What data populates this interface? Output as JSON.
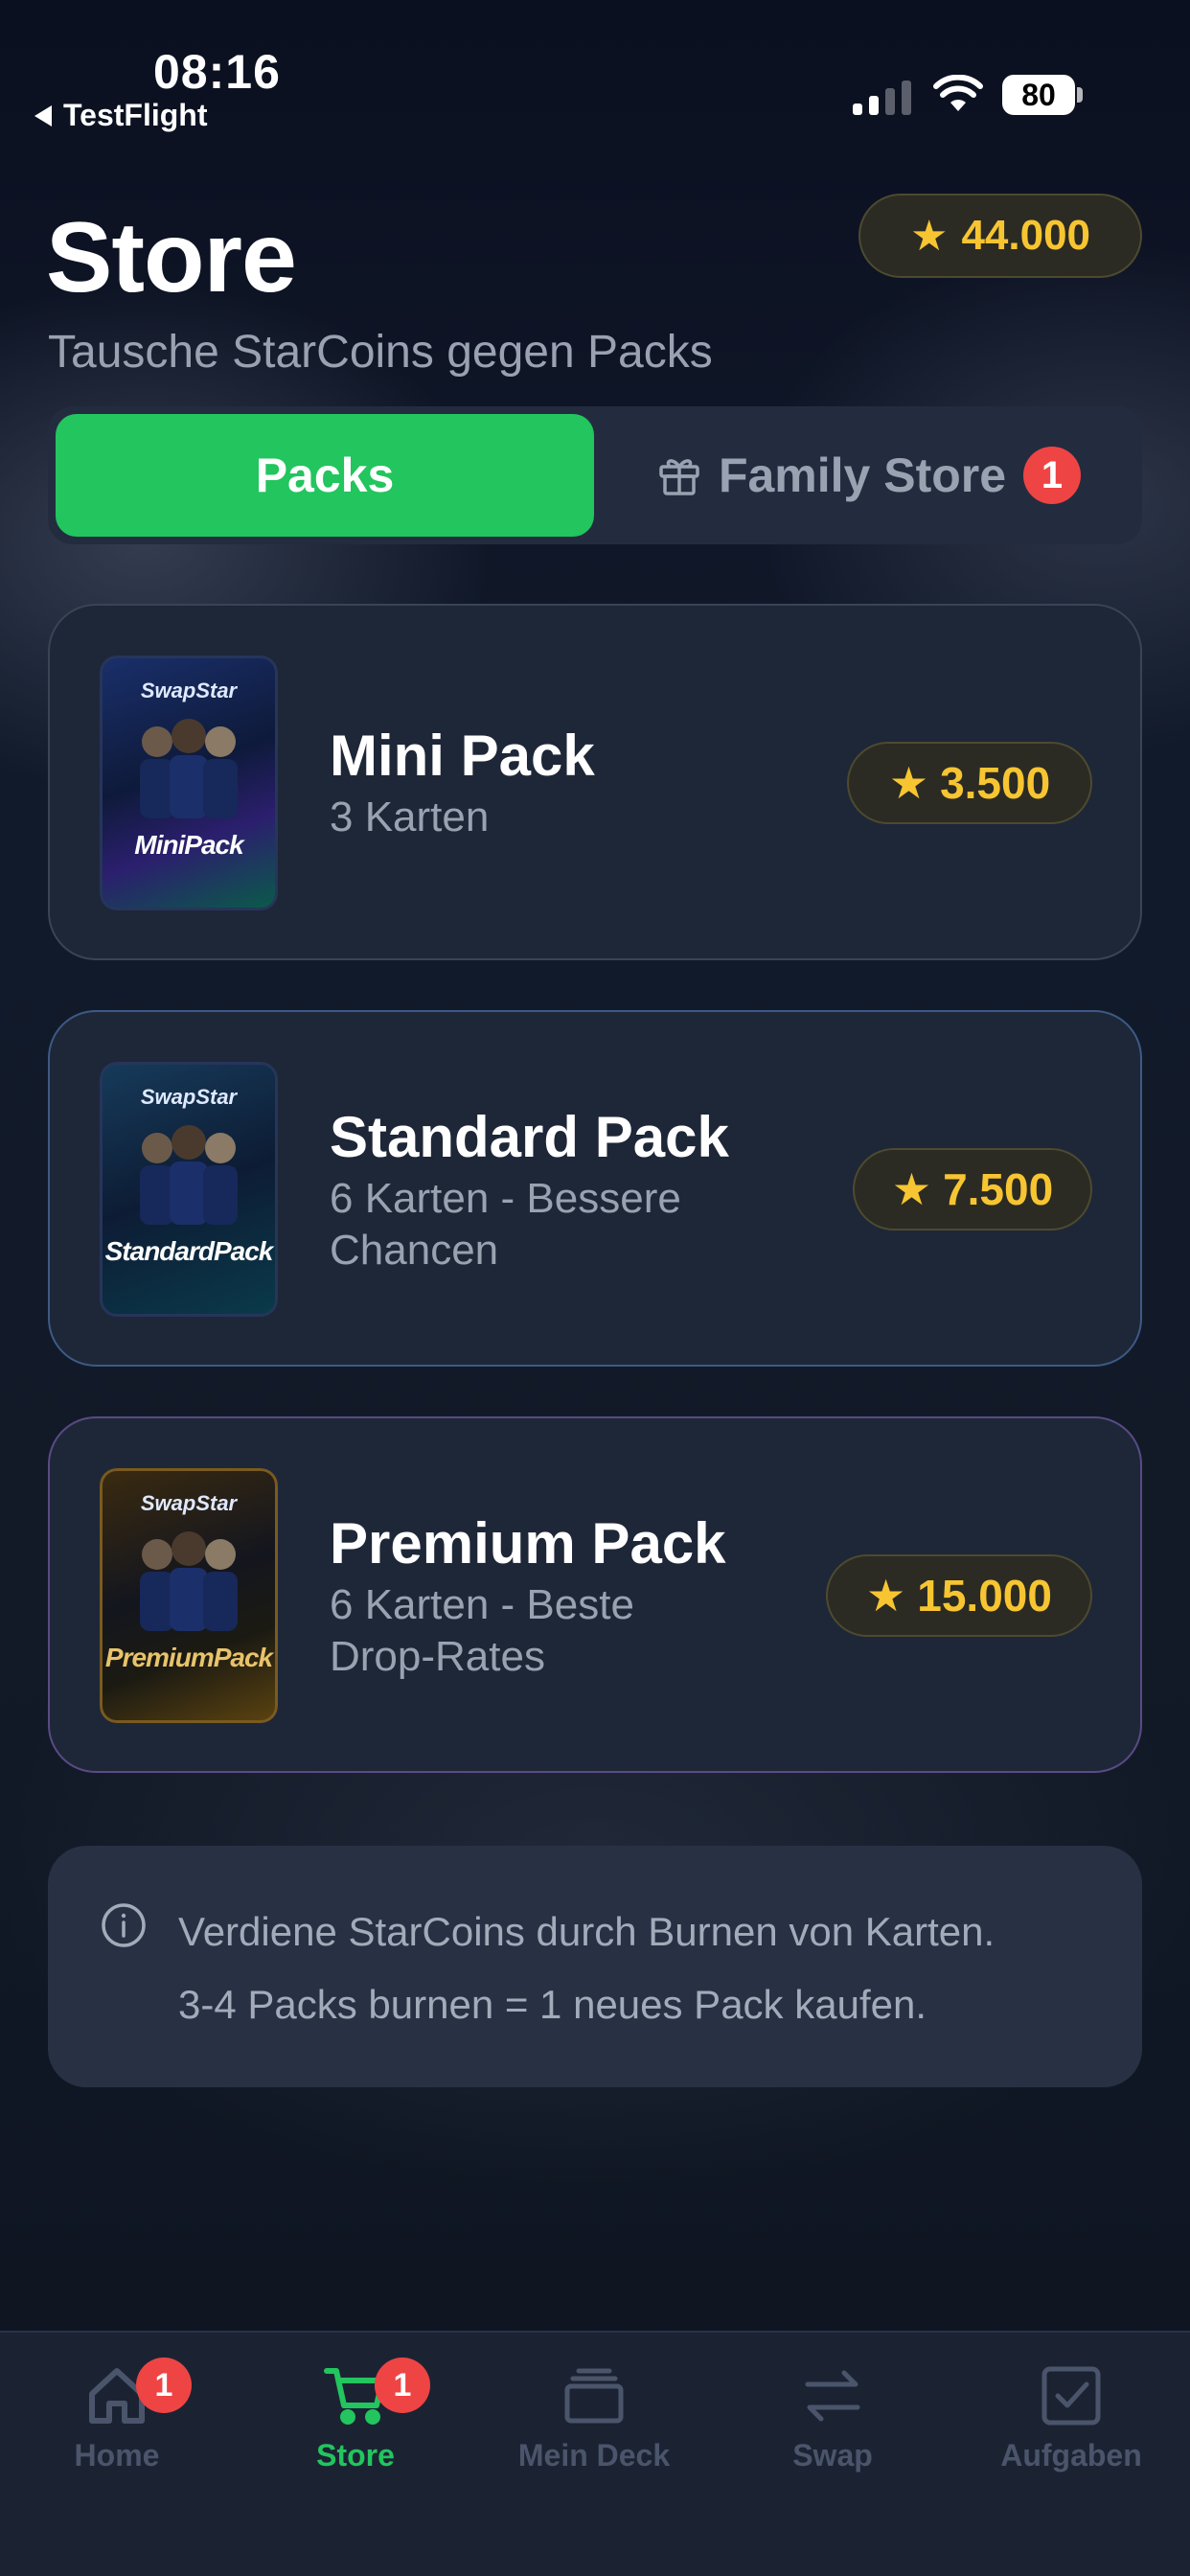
{
  "status_bar": {
    "time": "08:16",
    "back_app": "TestFlight",
    "battery": "80"
  },
  "header": {
    "title": "Store",
    "subtitle": "Tausche StarCoins gegen Packs",
    "balance": "44.000"
  },
  "tabs": {
    "packs": "Packs",
    "family_store": "Family Store",
    "family_badge": "1"
  },
  "packs": [
    {
      "name": "Mini Pack",
      "desc": "3 Karten",
      "price": "3.500",
      "image_brand": "SwapStar",
      "image_label": "MiniPack"
    },
    {
      "name": "Standard Pack",
      "desc": "6 Karten - Bessere Chancen",
      "price": "7.500",
      "image_brand": "SwapStar",
      "image_label": "StandardPack"
    },
    {
      "name": "Premium Pack",
      "desc": "6 Karten - Beste Drop-Rates",
      "price": "15.000",
      "image_brand": "SwapStar",
      "image_label": "PremiumPack"
    }
  ],
  "info": {
    "line1": "Verdiene StarCoins durch Burnen von Karten.",
    "line2": "3-4 Packs burnen = 1 neues Pack kaufen."
  },
  "tabbar": [
    {
      "label": "Home",
      "badge": "1",
      "icon": "home-icon"
    },
    {
      "label": "Store",
      "badge": "1",
      "icon": "cart-icon",
      "active": true
    },
    {
      "label": "Mein Deck",
      "icon": "deck-icon"
    },
    {
      "label": "Swap",
      "icon": "swap-icon"
    },
    {
      "label": "Aufgaben",
      "icon": "tasks-icon"
    }
  ],
  "colors": {
    "accent": "#22c55e",
    "gold": "#f7c531",
    "badge": "#ef4444"
  }
}
